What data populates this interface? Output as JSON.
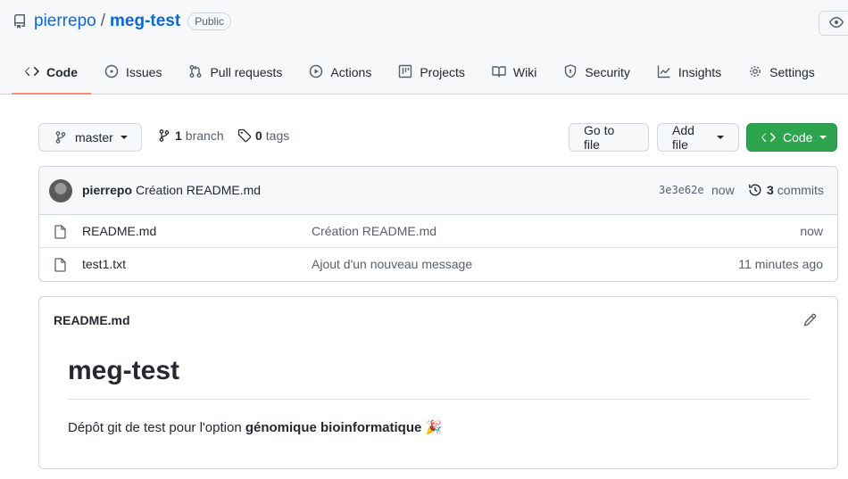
{
  "repo": {
    "owner": "pierrepo",
    "separator": "/",
    "name": "meg-test",
    "visibility": "Public"
  },
  "tabs": [
    {
      "label": "Code",
      "icon": "code-icon"
    },
    {
      "label": "Issues",
      "icon": "issue-icon"
    },
    {
      "label": "Pull requests",
      "icon": "pull-request-icon"
    },
    {
      "label": "Actions",
      "icon": "play-icon"
    },
    {
      "label": "Projects",
      "icon": "table-icon"
    },
    {
      "label": "Wiki",
      "icon": "book-icon"
    },
    {
      "label": "Security",
      "icon": "shield-icon"
    },
    {
      "label": "Insights",
      "icon": "graph-icon"
    },
    {
      "label": "Settings",
      "icon": "gear-icon"
    }
  ],
  "toolbar": {
    "branch": "master",
    "branch_count": "1",
    "branch_label": "branch",
    "tag_count": "0",
    "tag_label": "tags",
    "go_to_file": "Go to file",
    "add_file": "Add file",
    "code": "Code"
  },
  "commit": {
    "author": "pierrepo",
    "message": "Création README.md",
    "sha": "3e3e62e",
    "time": "now",
    "count": "3",
    "count_label": "commits"
  },
  "files": [
    {
      "name": "README.md",
      "message": "Création README.md",
      "time": "now"
    },
    {
      "name": "test1.txt",
      "message": "Ajout d'un nouveau message",
      "time": "11 minutes ago"
    }
  ],
  "readme": {
    "filename": "README.md",
    "title": "meg-test",
    "text_before": "Dépôt git de test pour l'option ",
    "text_bold": "génomique bioinformatique",
    "emoji": "🎉"
  },
  "colors": {
    "link": "#0969da",
    "accent_green": "#2da44e",
    "active_tab_underline": "#fd8c73"
  }
}
